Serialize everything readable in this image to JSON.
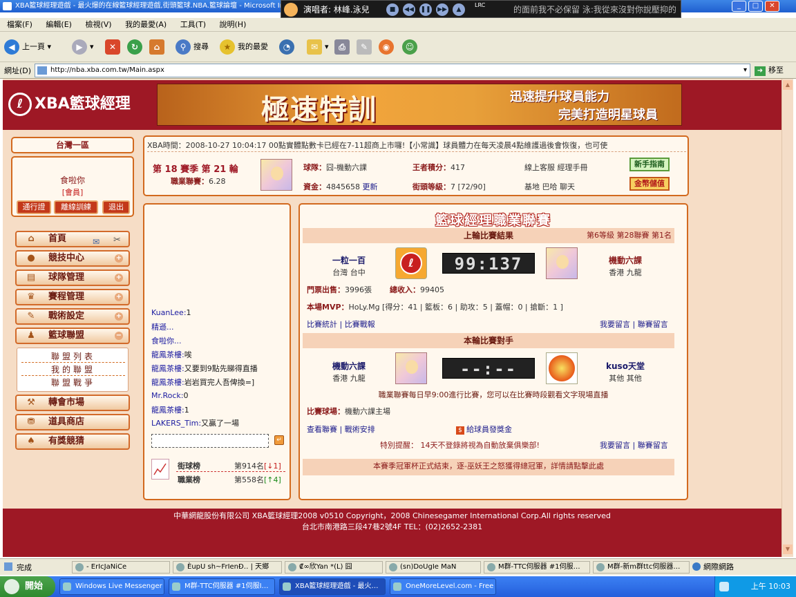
{
  "window": {
    "title": "XBA籃球經理遊戲 - 最火爆的在線籃球經理遊戲,街頭籃球.NBA.籃球論壇 - Microsoft Internet Explorer"
  },
  "lyric_player": {
    "text": "演唱者: 林峰.泳兒",
    "lyric": "的面前我不必保留  泳:我從來沒對你說壓抑的",
    "lrc_label": "LRC"
  },
  "menu": [
    "檔案(F)",
    "編輯(E)",
    "檢視(V)",
    "我的最愛(A)",
    "工具(T)",
    "說明(H)"
  ],
  "toolbar": {
    "back": "上一頁",
    "search": "搜尋",
    "favorites": "我的最愛"
  },
  "address": {
    "label": "網址(D)",
    "url": "http://nba.xba.com.tw/Main.aspx",
    "go": "移至"
  },
  "site": {
    "logo": "XBA籃球經理",
    "banner_big": "極速特訓",
    "banner_sub1": "迅速提升球員能力",
    "banner_sub2": "完美打造明星球員"
  },
  "left": {
    "server": "台灣一區",
    "username": "食啦你",
    "rank": "[會員]",
    "buttons": [
      "通行證",
      "離線訓練",
      "退出"
    ],
    "nav": [
      {
        "label": "首頁",
        "icon": "home-icon"
      },
      {
        "label": "競技中心",
        "icon": "ball-icon"
      },
      {
        "label": "球隊管理",
        "icon": "team-icon"
      },
      {
        "label": "賽程管理",
        "icon": "trophy-icon"
      },
      {
        "label": "戰術設定",
        "icon": "tactic-icon"
      },
      {
        "label": "籃球聯盟",
        "icon": "league-icon"
      },
      {
        "label": "轉會市場",
        "icon": "hammer-icon"
      },
      {
        "label": "道具商店",
        "icon": "shop-icon"
      },
      {
        "label": "有獎競猜",
        "icon": "spade-icon"
      }
    ],
    "sub_nav": [
      "聯盟列表",
      "我的聯盟",
      "聯盟戰爭"
    ]
  },
  "info": {
    "ticker": "XBA時間：2008-10-27 10:04:17     00點實體點數卡已經在7-11超商上市囉!【小常識】球員體力在每天凌晨4點維護過後會恢復，也可使",
    "season": "第 18 賽季  第 21 輪",
    "league_label": "職業聯賽：",
    "league_value": "6.28",
    "team_label": "球隊：",
    "team_value": "囧-機動六課",
    "funds_label": "資金：",
    "funds_value": "4845658",
    "funds_refresh": "更新",
    "king_label": "王者積分：",
    "king_value": "417",
    "level_label": "街頭等級：",
    "level_value": "7 [72/90]",
    "service": "線上客服",
    "manual": "經理手冊",
    "links": [
      "基地",
      "巴哈",
      "聊天"
    ],
    "newbie": "新手指南",
    "gold": "金幣儲值"
  },
  "chat": {
    "lines": [
      {
        "user": "KuanLee:",
        "msg": "1"
      },
      {
        "user": "精遜...",
        "msg": ""
      },
      {
        "user": "食啦你...",
        "msg": ""
      },
      {
        "user": "龍鳳茶樓:",
        "msg": "唉"
      },
      {
        "user": "龍鳳茶樓:",
        "msg": "又要到9點先睇得直播"
      },
      {
        "user": "龍鳳茶樓:",
        "msg": "岩岩買完人吾俾換=]"
      },
      {
        "user": "Mr.Rock:",
        "msg": "0"
      },
      {
        "user": "龍鳳茶樓:",
        "msg": "1"
      },
      {
        "user": "LAKERS_Tim:",
        "msg": "又贏了一場"
      }
    ],
    "street_rank_label": "街球榜",
    "street_rank_value": "第914名",
    "street_rank_change": "[↓1]",
    "pro_rank_label": "職業榜",
    "pro_rank_value": "第558名",
    "pro_rank_change": "[↑4]"
  },
  "league": {
    "title": "籃球經理職業聯賽",
    "last_result_header": "上輪比賽結果",
    "level_info": "第6等級  第28聯賽  第1名",
    "home_team": "一粒一百",
    "home_loc": "台灣  台中",
    "score": "99:137",
    "away_team": "機動六課",
    "away_loc": "香港  九龍",
    "tickets_label": "門票出售：",
    "tickets_value": "3996張",
    "income_label": "總收入：",
    "income_value": "99405",
    "mvp_label": "本場MVP：",
    "mvp_value": "HoLy.Mg [得分：41 | 籃板：6 | 助攻：5 | 蓋帽：0 | 搶斷：1 ]",
    "link_stats": "比賽統計",
    "link_report": "比賽戰報",
    "link_msg": "我要留言",
    "link_league_msg": "聯賽留言",
    "next_header": "本輪比賽對手",
    "next_home": "機動六課",
    "next_home_loc": "香港  九龍",
    "next_score": "--:--",
    "next_away": "kuso天堂",
    "next_away_loc": "其他  其他",
    "schedule_note": "職業聯賽每日早9:00進行比賽，您可以在比賽時段觀看文字現場直播",
    "venue_label": "比賽球場：",
    "venue_value": "機動六課主場",
    "link_view": "查看聯賽",
    "link_tactic": "戰術安排",
    "link_bonus": "給球員發獎金",
    "reminder": "特別提醒：  14天不登錄將視為自動放棄俱樂部!",
    "link_msg2": "我要留言",
    "link_league_msg2": "聯賽留言",
    "notice": "本賽季冠軍杯正式結束，逐-巫妖王之怒獲得總冠軍，詳情請點擊此處"
  },
  "footer": {
    "line1": "中華網龍股份有限公司  XBA籃球經理2008 v0510     Copyright，2008 Chinesegamer International Corp.All rights reserved",
    "line2": "台北市南港路三段47巷2號4F TEL：(02)2652-2381"
  },
  "statusbar": {
    "done": "完成",
    "zone": "網際網路",
    "cells": [
      "-        ErIcJaNiCe",
      "ÈupU ꜱh~FrIenÐ‥ | 天鄉",
      "₡∞欣Yan *(L) 囧",
      "(sn)DoUgIe MaN",
      "M群-TTC伺服器 #1伺服…",
      "M群-新m群ttc伺服器…"
    ]
  },
  "taskbar": {
    "start": "開始",
    "tasks": [
      "Windows Live Messenger",
      "M群-TTC伺服器 #1伺服I…",
      "XBA籃球經理遊戲 - 最火…",
      "OneMoreLevel.com - Free …"
    ],
    "tray": "上午 10:03"
  },
  "colors": {
    "site_red": "#9e1825",
    "page_bg": "#f6ddc6",
    "panel_border": "#d2691e"
  }
}
